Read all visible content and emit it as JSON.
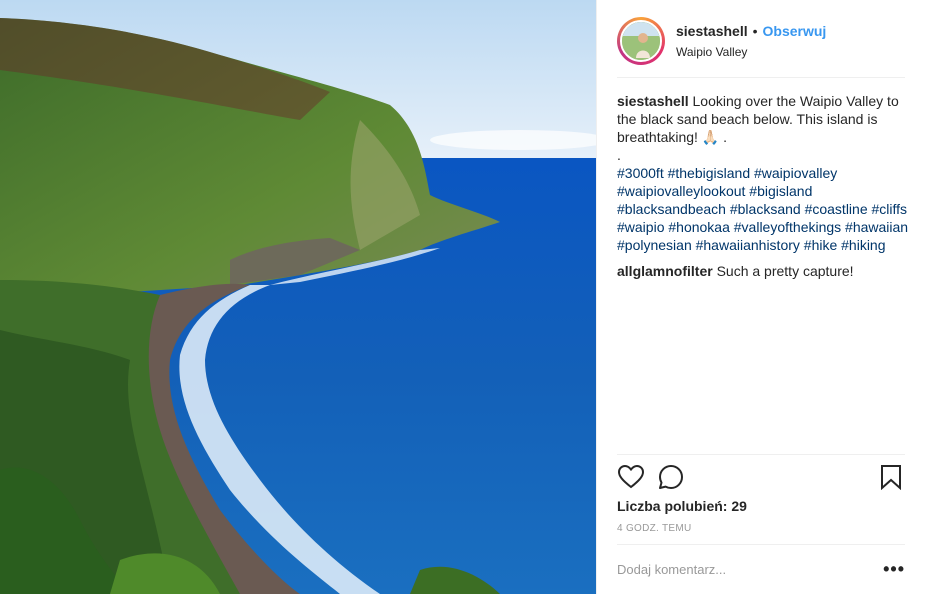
{
  "header": {
    "username": "siestashell",
    "separator": "•",
    "follow_label": "Obserwuj",
    "location": "Waipio Valley"
  },
  "caption": {
    "username": "siestashell",
    "text": "Looking over the Waipio Valley to the black sand beach below. This island is breathtaking! 🙏🏻 .",
    "dot_line": ".",
    "hashtags": "#3000ft #thebigisland #waipiovalley #waipiovalleylookout #bigisland #blacksandbeach #blacksand #coastline #cliffs #waipio #honokaa #valleyofthekings #hawaiian #polynesian #hawaiianhistory #hike #hiking"
  },
  "comments": [
    {
      "username": "allglamnofilter",
      "text": "Such a pretty capture!"
    }
  ],
  "actions": {
    "like_icon": "heart-icon",
    "comment_icon": "speech-bubble-icon",
    "save_icon": "bookmark-icon"
  },
  "likes_text": "Liczba polubień: 29",
  "timestamp": "4 GODZ. TEMU",
  "add_comment": {
    "placeholder": "Dodaj komentarz...",
    "more_label": "•••"
  },
  "colors": {
    "link_blue": "#3897f0",
    "hashtag_blue": "#003569",
    "ocean": "#1a5fa8"
  }
}
